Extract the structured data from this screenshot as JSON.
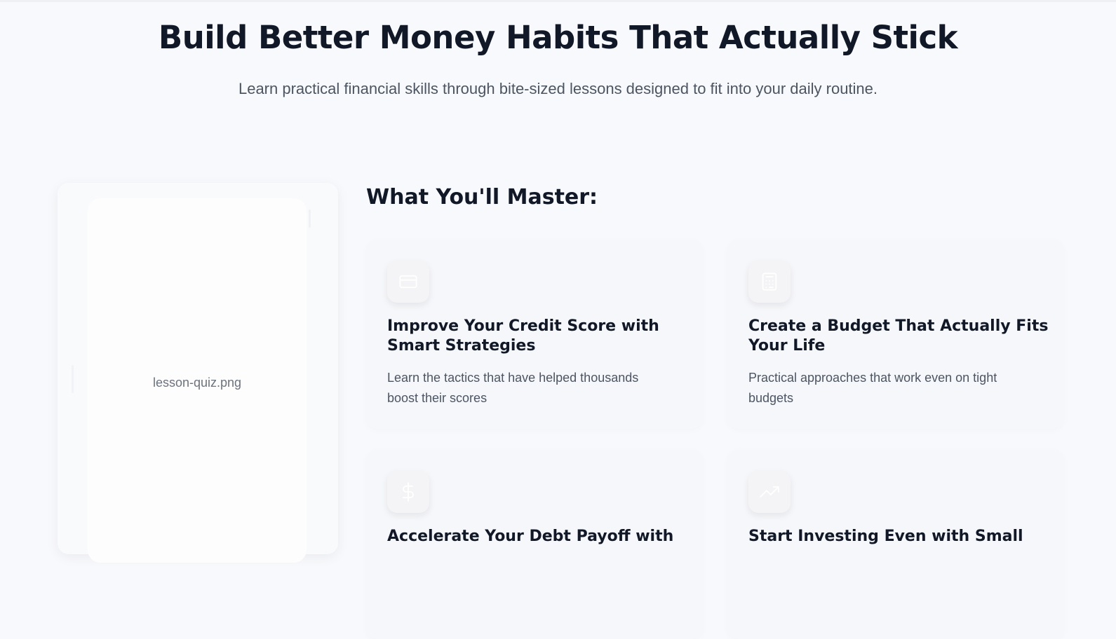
{
  "hero": {
    "title": "Build Better Money Habits That Actually Stick",
    "subtitle": "Learn practical financial skills through bite-sized lessons designed to fit into your daily routine."
  },
  "preview": {
    "image_label": "lesson-quiz.png"
  },
  "features": {
    "heading": "What You'll Master:",
    "items": [
      {
        "icon": "credit-card-icon",
        "title": "Improve Your Credit Score with Smart Strategies",
        "description": "Learn the tactics that have helped thousands boost their scores"
      },
      {
        "icon": "calculator-icon",
        "title": "Create a Budget That Actually Fits Your Life",
        "description": "Practical approaches that work even on tight budgets"
      },
      {
        "icon": "dollar-icon",
        "title": "Accelerate Your Debt Payoff with",
        "description": ""
      },
      {
        "icon": "trending-up-icon",
        "title": "Start Investing Even with Small",
        "description": ""
      }
    ]
  },
  "colors": {
    "background": "#f8f9fc",
    "heading": "#111827",
    "body_text": "#4b5563",
    "muted_text": "#6b7280",
    "icon_stroke": "#ffffff"
  }
}
